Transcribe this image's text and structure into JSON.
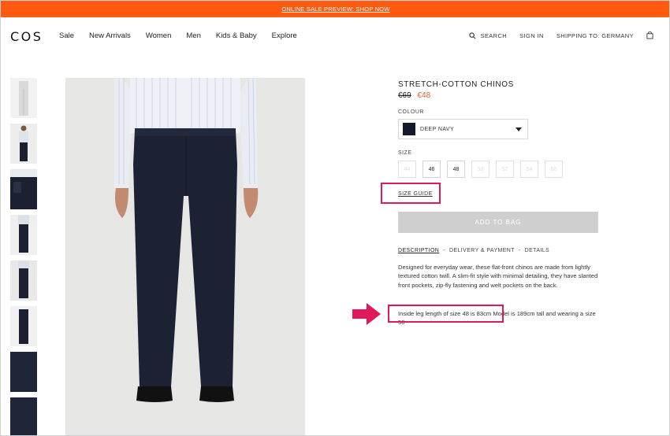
{
  "promo": {
    "text": "ONLINE SALE PREVIEW: SHOP NOW"
  },
  "nav": {
    "logo": "COS",
    "menu": [
      "Sale",
      "New Arrivals",
      "Women",
      "Men",
      "Kids & Baby",
      "Explore"
    ],
    "search": "SEARCH",
    "signin": "SIGN IN",
    "shipping": "SHIPPING TO: GERMANY"
  },
  "product": {
    "title": "STRETCH-COTTON CHINOS",
    "price_old": "€69",
    "price_new": "€48",
    "colour_label": "COLOUR",
    "colour_value": "DEEP NAVY",
    "size_label": "SIZE",
    "sizes": [
      "44",
      "46",
      "48",
      "50",
      "52",
      "54",
      "56"
    ],
    "size_guide": "SIZE GUIDE",
    "add_to_bag": "ADD TO BAG",
    "tabs": [
      "DESCRIPTION",
      "DELIVERY & PAYMENT",
      "DETAILS"
    ],
    "tab_separator": "-",
    "description": "Designed for everyday wear, these flat-front chinos are made from lightly textured cotton twill. A slim-fit style with minimal detailing, they have slanted front pockets, zip-fly fastening and welt pockets on the back.",
    "leg_highlight": "Inside leg length of size 48 is 83cm",
    "leg_rest": " Model is 189cm tall and wearing a size 50"
  },
  "colors": {
    "promo_bg": "#ff5a10",
    "accent_price": "#e8603a",
    "highlight": "#e0195a",
    "swatch": "#141a2b"
  }
}
